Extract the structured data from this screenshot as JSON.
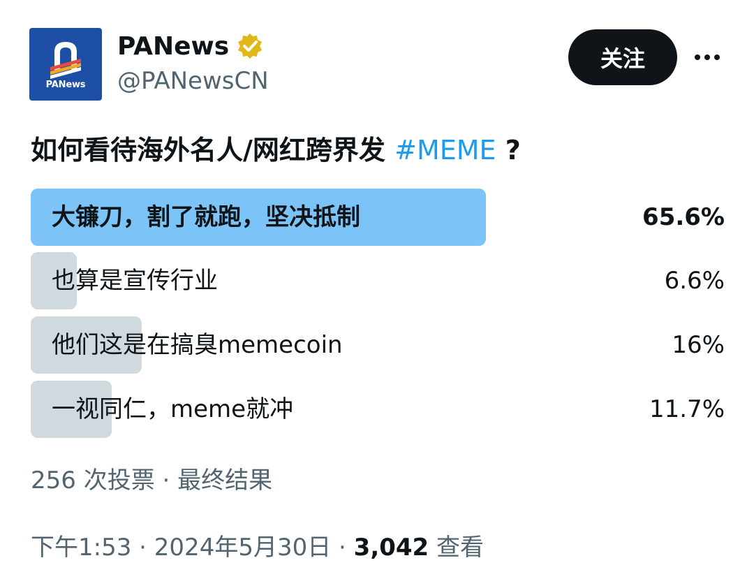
{
  "account": {
    "display_name": "PANews",
    "handle": "@PANewsCN",
    "avatar_text": "PANews",
    "verified": true,
    "verified_badge": "gold-check-icon"
  },
  "actions": {
    "follow_label": "关注",
    "more_icon": "more-horizontal-icon"
  },
  "post": {
    "question_text": "如何看待海外名人/网红跨界发 ",
    "hashtag": "#MEME",
    "question_suffix": " ?"
  },
  "poll": {
    "options": [
      {
        "label": "大镰刀，割了就跑，坚决抵制",
        "percent_label": "65.6%",
        "percent": 65.6,
        "winner": true
      },
      {
        "label": "也算是宣传行业",
        "percent_label": "6.6%",
        "percent": 6.6,
        "winner": false
      },
      {
        "label": "他们这是在搞臭memecoin",
        "percent_label": "16%",
        "percent": 16,
        "winner": false
      },
      {
        "label": "一视同仁，meme就冲",
        "percent_label": "11.7%",
        "percent": 11.7,
        "winner": false
      }
    ],
    "votes": "256 次投票",
    "separator": " · ",
    "status": "最终结果"
  },
  "meta": {
    "time": "下午1:53",
    "separator": " · ",
    "date": "2024年5月30日",
    "views_count": "3,042",
    "views_label": "查看"
  },
  "colors": {
    "winner_bar": "#7cc3f7",
    "loser_bar": "#cfd9de",
    "hashtag": "#1d9bf0",
    "secondary_text": "#536471",
    "follow_button": "#0f1419",
    "avatar_bg": "#1d4fa6",
    "verified_gold": "#e2b719"
  }
}
